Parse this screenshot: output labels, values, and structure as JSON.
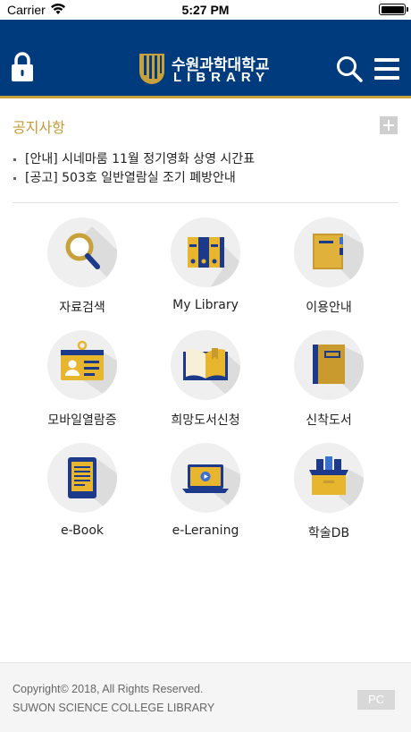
{
  "status_bar": {
    "carrier": "Carrier",
    "time": "5:27 PM"
  },
  "header": {
    "logo_name": "수원과학대학교",
    "logo_sub": "LIBRARY"
  },
  "notice": {
    "title": "공지사항",
    "items": [
      "[안내] 시네마룸 11월 정기영화 상영 시간표",
      "[공고] 503호 일반열람실 조기 폐방안내"
    ]
  },
  "menu": [
    {
      "label": "자료검색",
      "icon": "magnifier-icon"
    },
    {
      "label": "My Library",
      "icon": "bookshelf-icon"
    },
    {
      "label": "이용안내",
      "icon": "guide-book-icon"
    },
    {
      "label": "모바일열람증",
      "icon": "id-card-icon"
    },
    {
      "label": "희망도서신청",
      "icon": "open-book-icon"
    },
    {
      "label": "신착도서",
      "icon": "new-book-icon"
    },
    {
      "label": "e-Book",
      "icon": "ebook-reader-icon"
    },
    {
      "label": "e-Leraning",
      "icon": "laptop-play-icon"
    },
    {
      "label": "학술DB",
      "icon": "database-box-icon"
    }
  ],
  "footer": {
    "copyright": "Copyright© 2018, All Rights Reserved.",
    "college": "SUWON SCIENCE COLLEGE LIBRARY",
    "pc_label": "PC"
  },
  "colors": {
    "header_bg": "#003b7e",
    "accent_gold": "#c9a13a",
    "navy": "#1d3a8a",
    "tile_bg": "#efefef"
  }
}
